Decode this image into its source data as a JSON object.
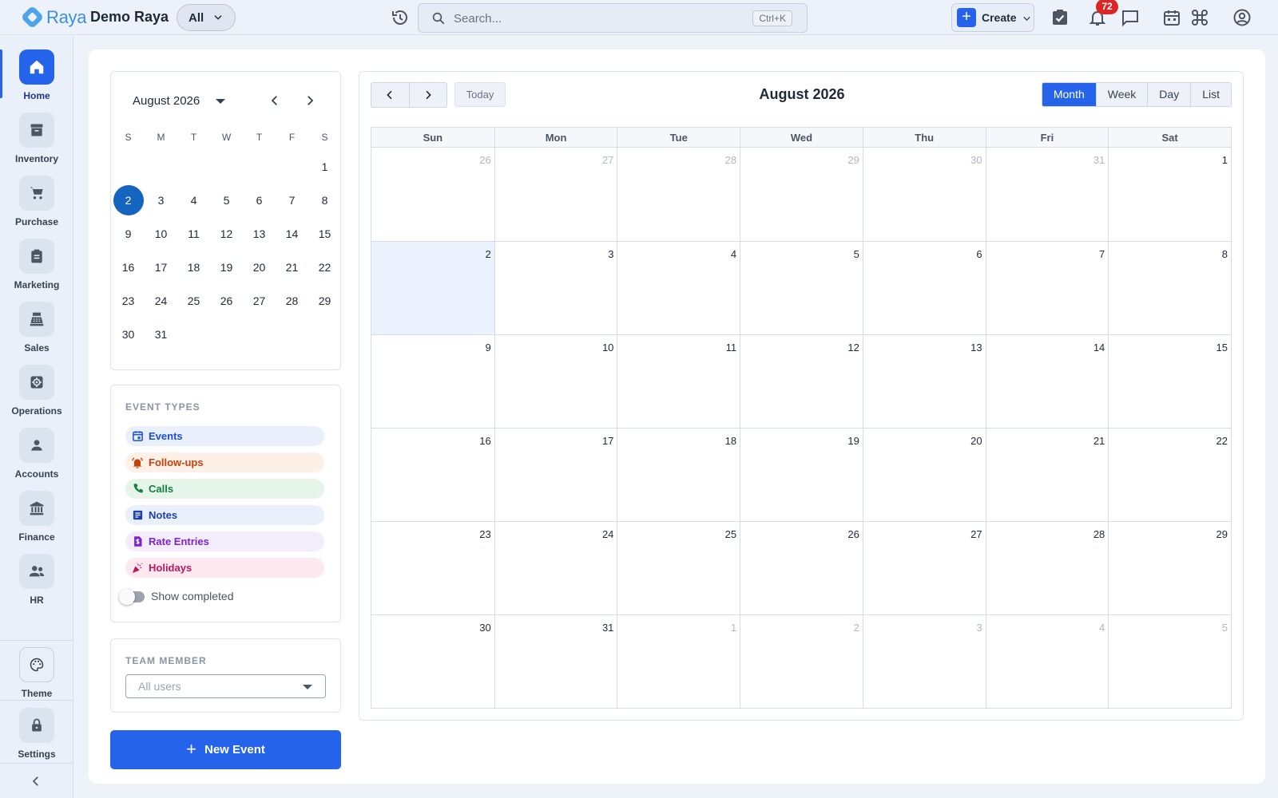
{
  "topbar": {
    "logo_text": "Raya",
    "company": "Demo Raya",
    "scope": "All",
    "search_placeholder": "Search...",
    "search_shortcut": "Ctrl+K",
    "create_label": "Create",
    "notification_count": "72"
  },
  "sidebar": {
    "items": [
      {
        "label": "Home",
        "icon": "home-icon"
      },
      {
        "label": "Inventory",
        "icon": "archive-icon"
      },
      {
        "label": "Purchase",
        "icon": "cart-icon"
      },
      {
        "label": "Marketing",
        "icon": "clipboard-icon"
      },
      {
        "label": "Sales",
        "icon": "register-icon"
      },
      {
        "label": "Operations",
        "icon": "cog-icon"
      },
      {
        "label": "Accounts",
        "icon": "person-icon"
      },
      {
        "label": "Finance",
        "icon": "bank-icon"
      },
      {
        "label": "HR",
        "icon": "people-icon"
      }
    ],
    "theme_label": "Theme",
    "settings_label": "Settings",
    "active_index": 0
  },
  "mini_calendar": {
    "month_label": "August 2026",
    "weekdays": [
      "S",
      "M",
      "T",
      "W",
      "T",
      "F",
      "S"
    ],
    "leading_blanks": 6,
    "days": [
      "1",
      "2",
      "3",
      "4",
      "5",
      "6",
      "7",
      "8",
      "9",
      "10",
      "11",
      "12",
      "13",
      "14",
      "15",
      "16",
      "17",
      "18",
      "19",
      "20",
      "21",
      "22",
      "23",
      "24",
      "25",
      "26",
      "27",
      "28",
      "29",
      "30",
      "31"
    ],
    "selected_day": "2"
  },
  "event_types": {
    "title": "EVENT TYPES",
    "items": [
      {
        "label": "Events",
        "icon": "calendar-icon",
        "color": "#1d4ed8",
        "bg": "#e9effb"
      },
      {
        "label": "Follow-ups",
        "icon": "bell-ring-icon",
        "color": "#c2410c",
        "bg": "#fdf0e6"
      },
      {
        "label": "Calls",
        "icon": "phone-icon",
        "color": "#15803d",
        "bg": "#e5f5ea"
      },
      {
        "label": "Notes",
        "icon": "note-icon",
        "color": "#1e40af",
        "bg": "#e9effb"
      },
      {
        "label": "Rate Entries",
        "icon": "dollar-file-icon",
        "color": "#7e22ce",
        "bg": "#f3ecfb"
      },
      {
        "label": "Holidays",
        "icon": "party-popper-icon",
        "color": "#be185d",
        "bg": "#fce8ef"
      }
    ],
    "show_completed_label": "Show completed",
    "show_completed": false
  },
  "team": {
    "title": "TEAM MEMBER",
    "selected": "All users"
  },
  "new_event_label": "New Event",
  "calendar": {
    "title": "August 2026",
    "today_label": "Today",
    "views": [
      "Month",
      "Week",
      "Day",
      "List"
    ],
    "active_view": "Month",
    "weekdays": [
      "Sun",
      "Mon",
      "Tue",
      "Wed",
      "Thu",
      "Fri",
      "Sat"
    ],
    "weeks": [
      [
        {
          "d": "26",
          "o": true
        },
        {
          "d": "27",
          "o": true
        },
        {
          "d": "28",
          "o": true
        },
        {
          "d": "29",
          "o": true
        },
        {
          "d": "30",
          "o": true
        },
        {
          "d": "31",
          "o": true
        },
        {
          "d": "1"
        }
      ],
      [
        {
          "d": "2",
          "t": true
        },
        {
          "d": "3"
        },
        {
          "d": "4"
        },
        {
          "d": "5"
        },
        {
          "d": "6"
        },
        {
          "d": "7"
        },
        {
          "d": "8"
        }
      ],
      [
        {
          "d": "9"
        },
        {
          "d": "10"
        },
        {
          "d": "11"
        },
        {
          "d": "12"
        },
        {
          "d": "13"
        },
        {
          "d": "14"
        },
        {
          "d": "15"
        }
      ],
      [
        {
          "d": "16"
        },
        {
          "d": "17"
        },
        {
          "d": "18"
        },
        {
          "d": "19"
        },
        {
          "d": "20"
        },
        {
          "d": "21"
        },
        {
          "d": "22"
        }
      ],
      [
        {
          "d": "23"
        },
        {
          "d": "24"
        },
        {
          "d": "25"
        },
        {
          "d": "26"
        },
        {
          "d": "27"
        },
        {
          "d": "28"
        },
        {
          "d": "29"
        }
      ],
      [
        {
          "d": "30"
        },
        {
          "d": "31"
        },
        {
          "d": "1",
          "o": true
        },
        {
          "d": "2",
          "o": true
        },
        {
          "d": "3",
          "o": true
        },
        {
          "d": "4",
          "o": true
        },
        {
          "d": "5",
          "o": true
        }
      ]
    ]
  }
}
